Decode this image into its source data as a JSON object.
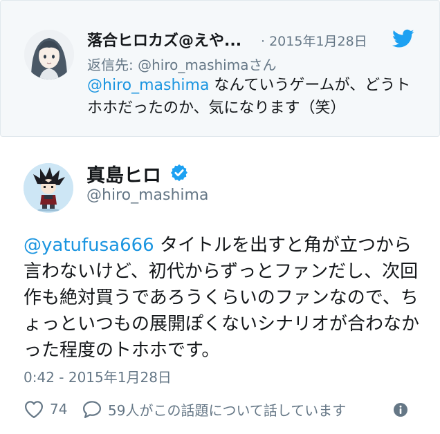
{
  "parent_tweet": {
    "display_name": "落合ヒロカズ@えや...",
    "separator": "·",
    "date": "2015年1月28日",
    "reply_to_label": "返信先: @hiro_mashimaさん",
    "mention": "@hiro_mashima",
    "text": " なんていうゲームが、どうトホホだったのか、気になります（笑）",
    "icons": {
      "avatar": "avatar-girl-illustration",
      "brand": "twitter-bird-icon"
    }
  },
  "main_tweet": {
    "display_name": "真島ヒロ",
    "handle": "@hiro_mashima",
    "mention": "@yatufusa666",
    "text": " タイトルを出すと角が立つから言わないけど、初代からずっとファンだし、次回作も絶対買うであろうくらいのファンなので、ちょっといつもの展開ぽくないシナリオが合わなかった程度のトホホです。",
    "timestamp": "0:42 - 2015年1月28日",
    "like_count": "74",
    "conversation_text": "59人がこの話題について話しています",
    "icons": {
      "avatar": "avatar-manga-character",
      "verified": "verified-badge-icon",
      "like": "heart-icon",
      "reply": "speech-bubble-icon",
      "info": "info-icon"
    }
  },
  "colors": {
    "accent": "#1da1f2",
    "link": "#1b95e0",
    "secondary_text": "#657786",
    "parent_background": "#f5f8fa"
  }
}
